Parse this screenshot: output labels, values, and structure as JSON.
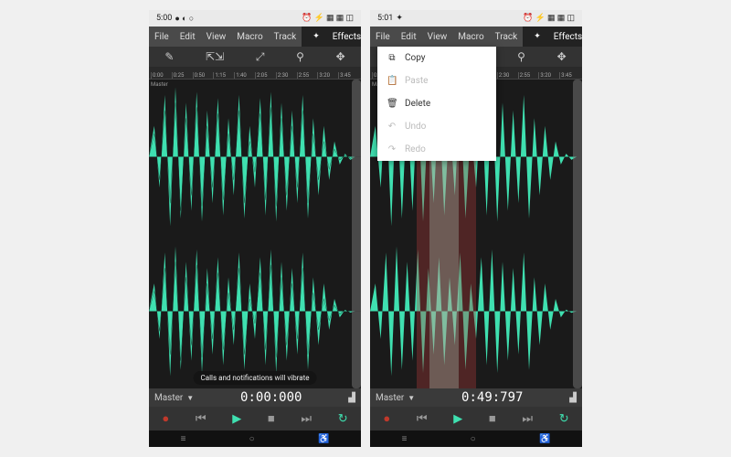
{
  "screens": {
    "left": {
      "status": {
        "time": "5:00",
        "icons_left": "● ◐ ○",
        "icons_right": "⏰ ⚡ ▦ ▦ ◫"
      },
      "timecode": "0:00:000",
      "toast": "Calls and notifications will vibrate",
      "track_selector": "Master"
    },
    "right": {
      "status": {
        "time": "5:01",
        "icons_left": "✦",
        "icons_right": "⏰ ⚡ ▦ ▦ ◫"
      },
      "timecode": "0:49:797",
      "track_selector": "Master"
    }
  },
  "menu": {
    "items": [
      "File",
      "Edit",
      "View",
      "Macro",
      "Track"
    ],
    "effects": "Effects"
  },
  "tools": {
    "pencil": "✎",
    "crop": "⇱⇲",
    "zoom_out": "⤢",
    "zoom": "⚲",
    "move": "✥"
  },
  "ruler": [
    "0:00",
    "0:25",
    "0:50",
    "1:15",
    "1:40",
    "2:05",
    "2:30",
    "2:55",
    "3:20",
    "3:45"
  ],
  "track_label": "Master",
  "context_menu": [
    {
      "icon": "⧉",
      "label": "Copy",
      "enabled": true
    },
    {
      "icon": "📋",
      "label": "Paste",
      "enabled": false
    },
    {
      "icon": "🗑",
      "label": "Delete",
      "enabled": true
    },
    {
      "icon": "↶",
      "label": "Undo",
      "enabled": false
    },
    {
      "icon": "↷",
      "label": "Redo",
      "enabled": false
    }
  ],
  "transport": {
    "record": "●",
    "prev": "⏮",
    "play": "▶",
    "stop": "■",
    "next": "⏭",
    "loop": "↻"
  },
  "nav": {
    "back": "≡",
    "home": "○",
    "recent": "♿"
  },
  "colors": {
    "waveform": "#3fe0b0",
    "bg": "#1a1a1a",
    "selection": "#8b3a3a",
    "accent": "#3fe0b0"
  }
}
